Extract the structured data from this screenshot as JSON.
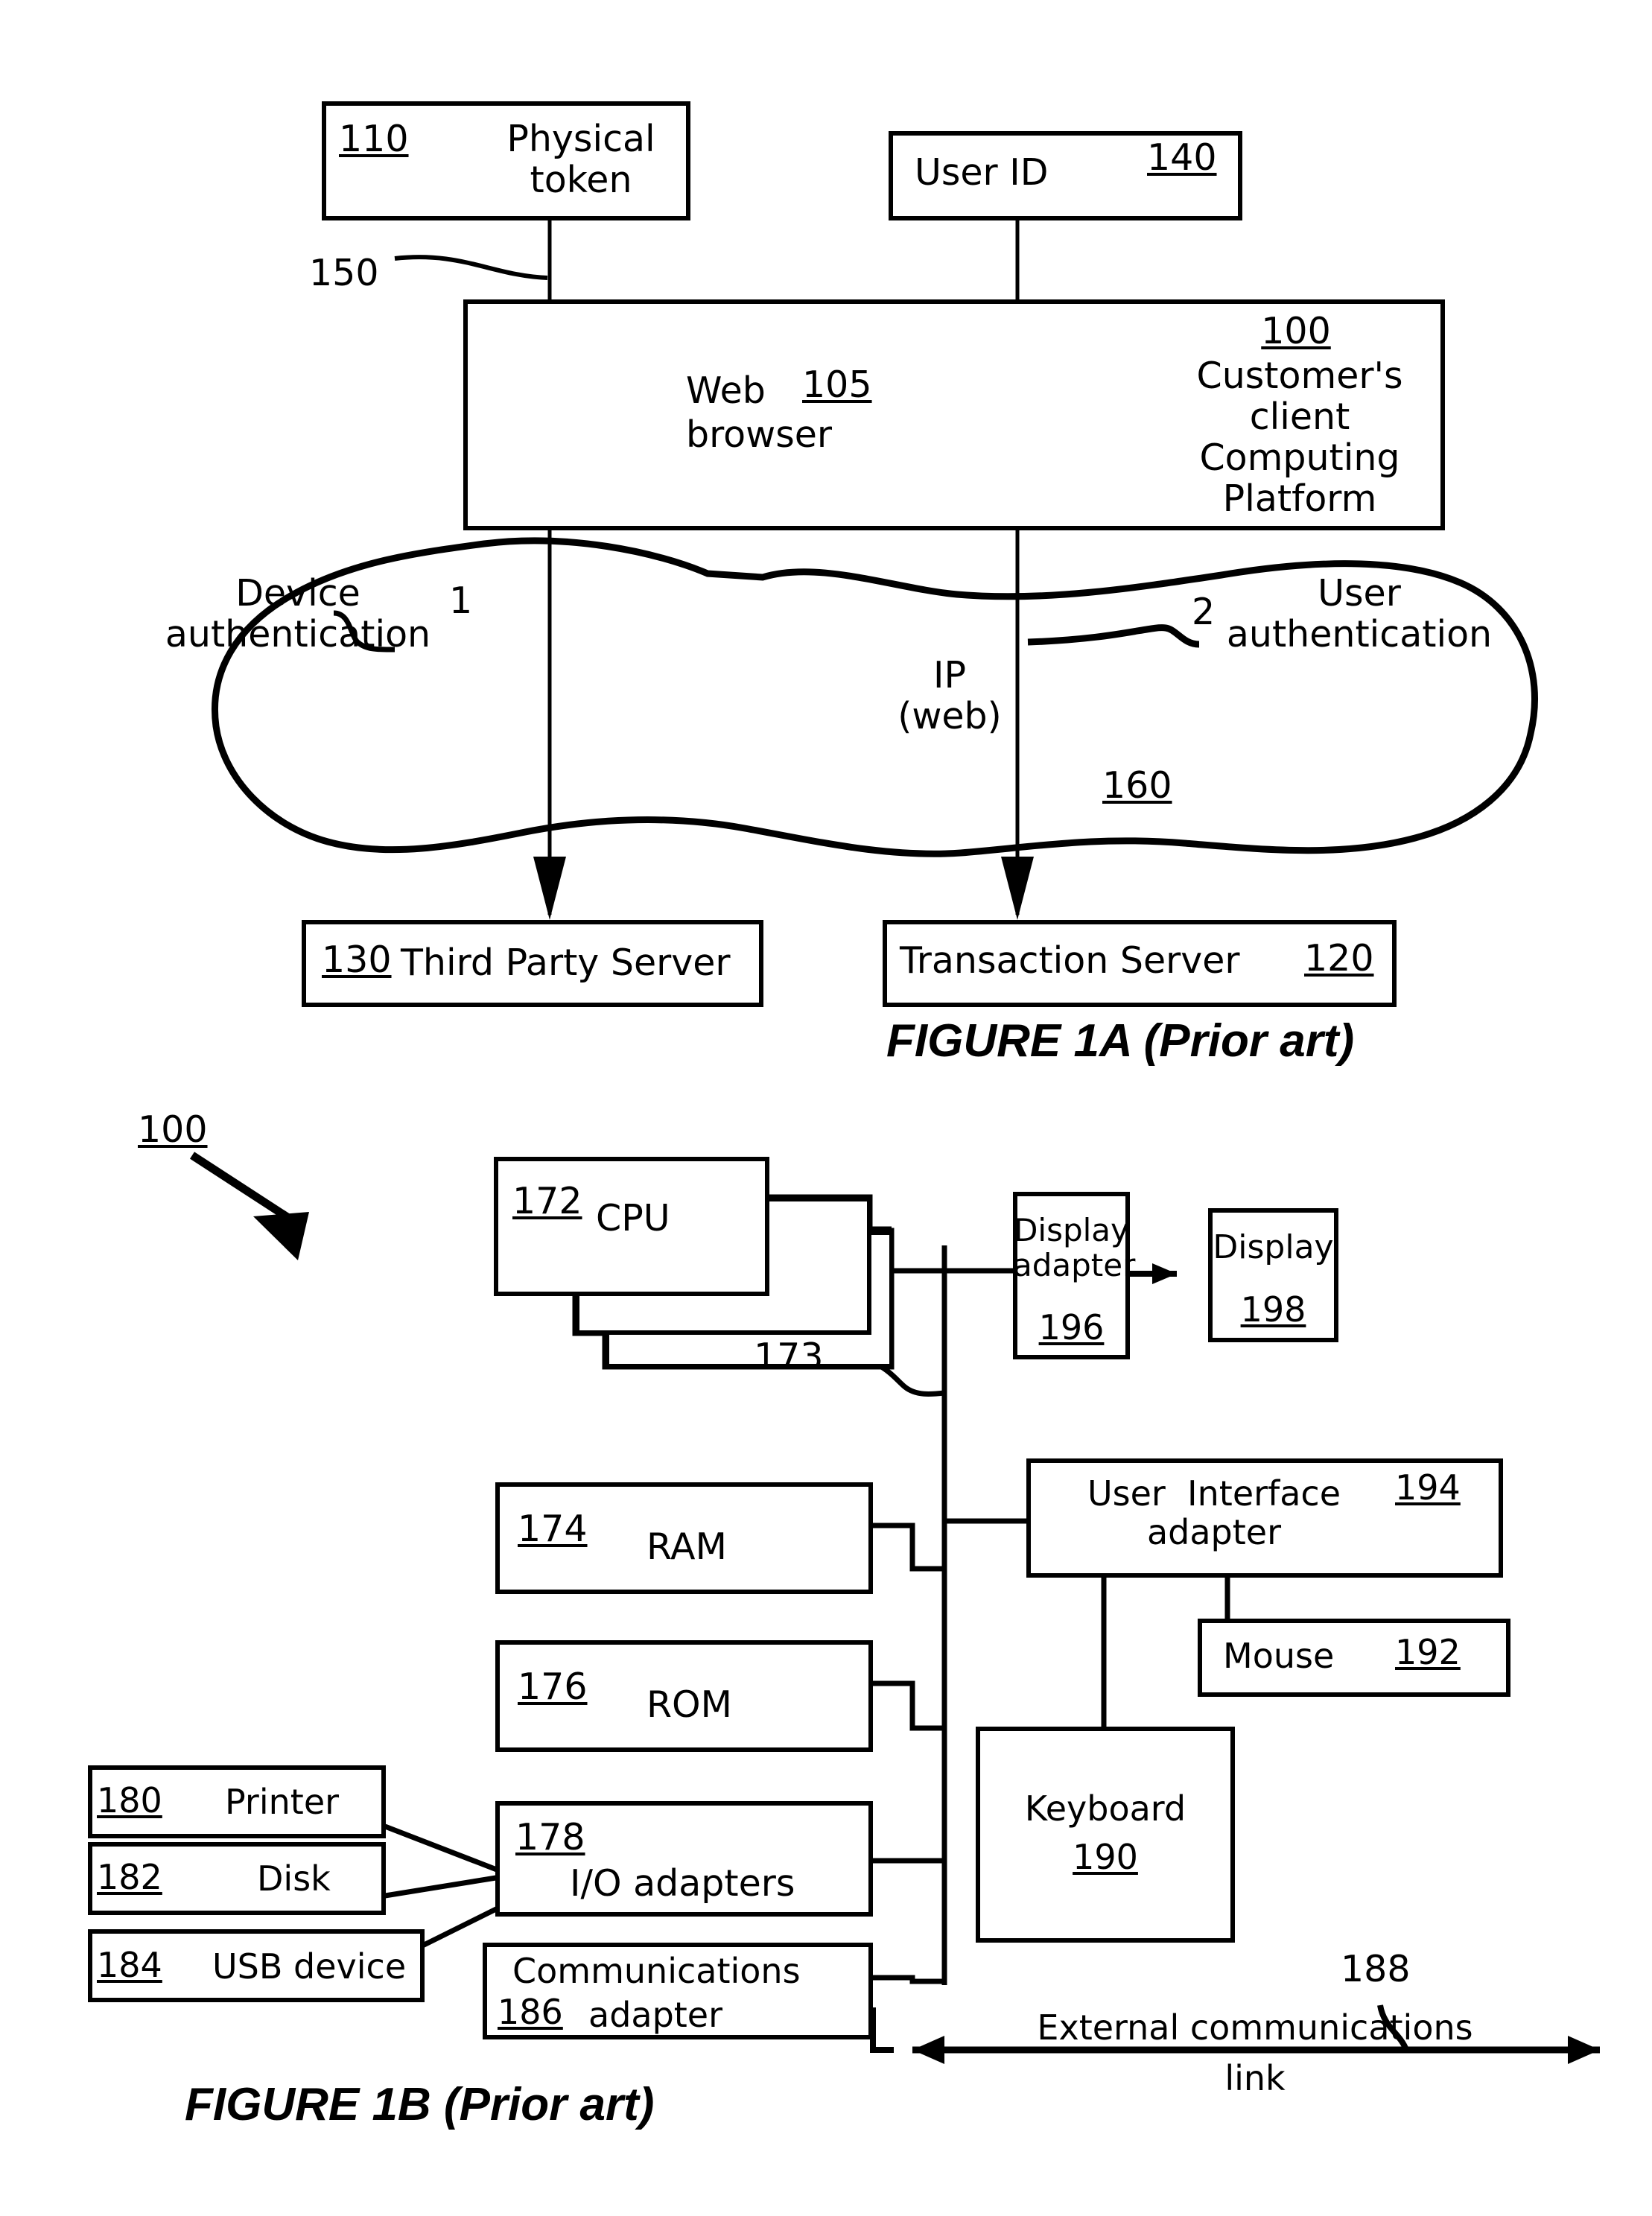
{
  "figure_1a": {
    "caption": "FIGURE 1A (Prior art)",
    "physical_token": {
      "ref": "110",
      "label": "Physical\ntoken"
    },
    "user_id": {
      "ref": "140",
      "label": "User ID"
    },
    "client_platform": {
      "ref": "100",
      "label": "Customer's\nclient\nComputing\nPlatform"
    },
    "web_browser": {
      "ref": "105",
      "label_left": "Web",
      "label_bottom": "browser"
    },
    "link_150": {
      "ref": "150"
    },
    "device_auth": {
      "label": "Device\nauthentication",
      "step": "1"
    },
    "user_auth": {
      "label": "User\nauthentication",
      "step": "2"
    },
    "network": {
      "ref": "160",
      "label": "IP\n(web)"
    },
    "third_party_server": {
      "ref": "130",
      "label": "Third Party Server"
    },
    "transaction_server": {
      "ref": "120",
      "label": "Transaction Server"
    }
  },
  "figure_1b": {
    "caption": "FIGURE 1B (Prior art)",
    "system_ref": "100",
    "bus_ref": "173",
    "ext_link_ref": "188",
    "cpu": {
      "ref": "172",
      "label": "CPU"
    },
    "display_adapter": {
      "ref": "196",
      "label": "Display\nadapter"
    },
    "display": {
      "ref": "198",
      "label": "Display"
    },
    "ui_adapter": {
      "ref": "194",
      "label": "User  Interface\nadapter"
    },
    "mouse": {
      "ref": "192",
      "label": "Mouse"
    },
    "keyboard": {
      "ref": "190",
      "label": "Keyboard"
    },
    "ram": {
      "ref": "174",
      "label": "RAM"
    },
    "rom": {
      "ref": "176",
      "label": "ROM"
    },
    "io_adapters": {
      "ref": "178",
      "label": "I/O adapters"
    },
    "comms_adapter": {
      "ref": "186",
      "label_top": "Communications",
      "label_bottom": "adapter"
    },
    "printer": {
      "ref": "180",
      "label": "Printer"
    },
    "disk": {
      "ref": "182",
      "label": "Disk"
    },
    "usb_device": {
      "ref": "184",
      "label": "USB device"
    },
    "external_link": {
      "label_top": "External communications",
      "label_bottom": "link"
    }
  }
}
